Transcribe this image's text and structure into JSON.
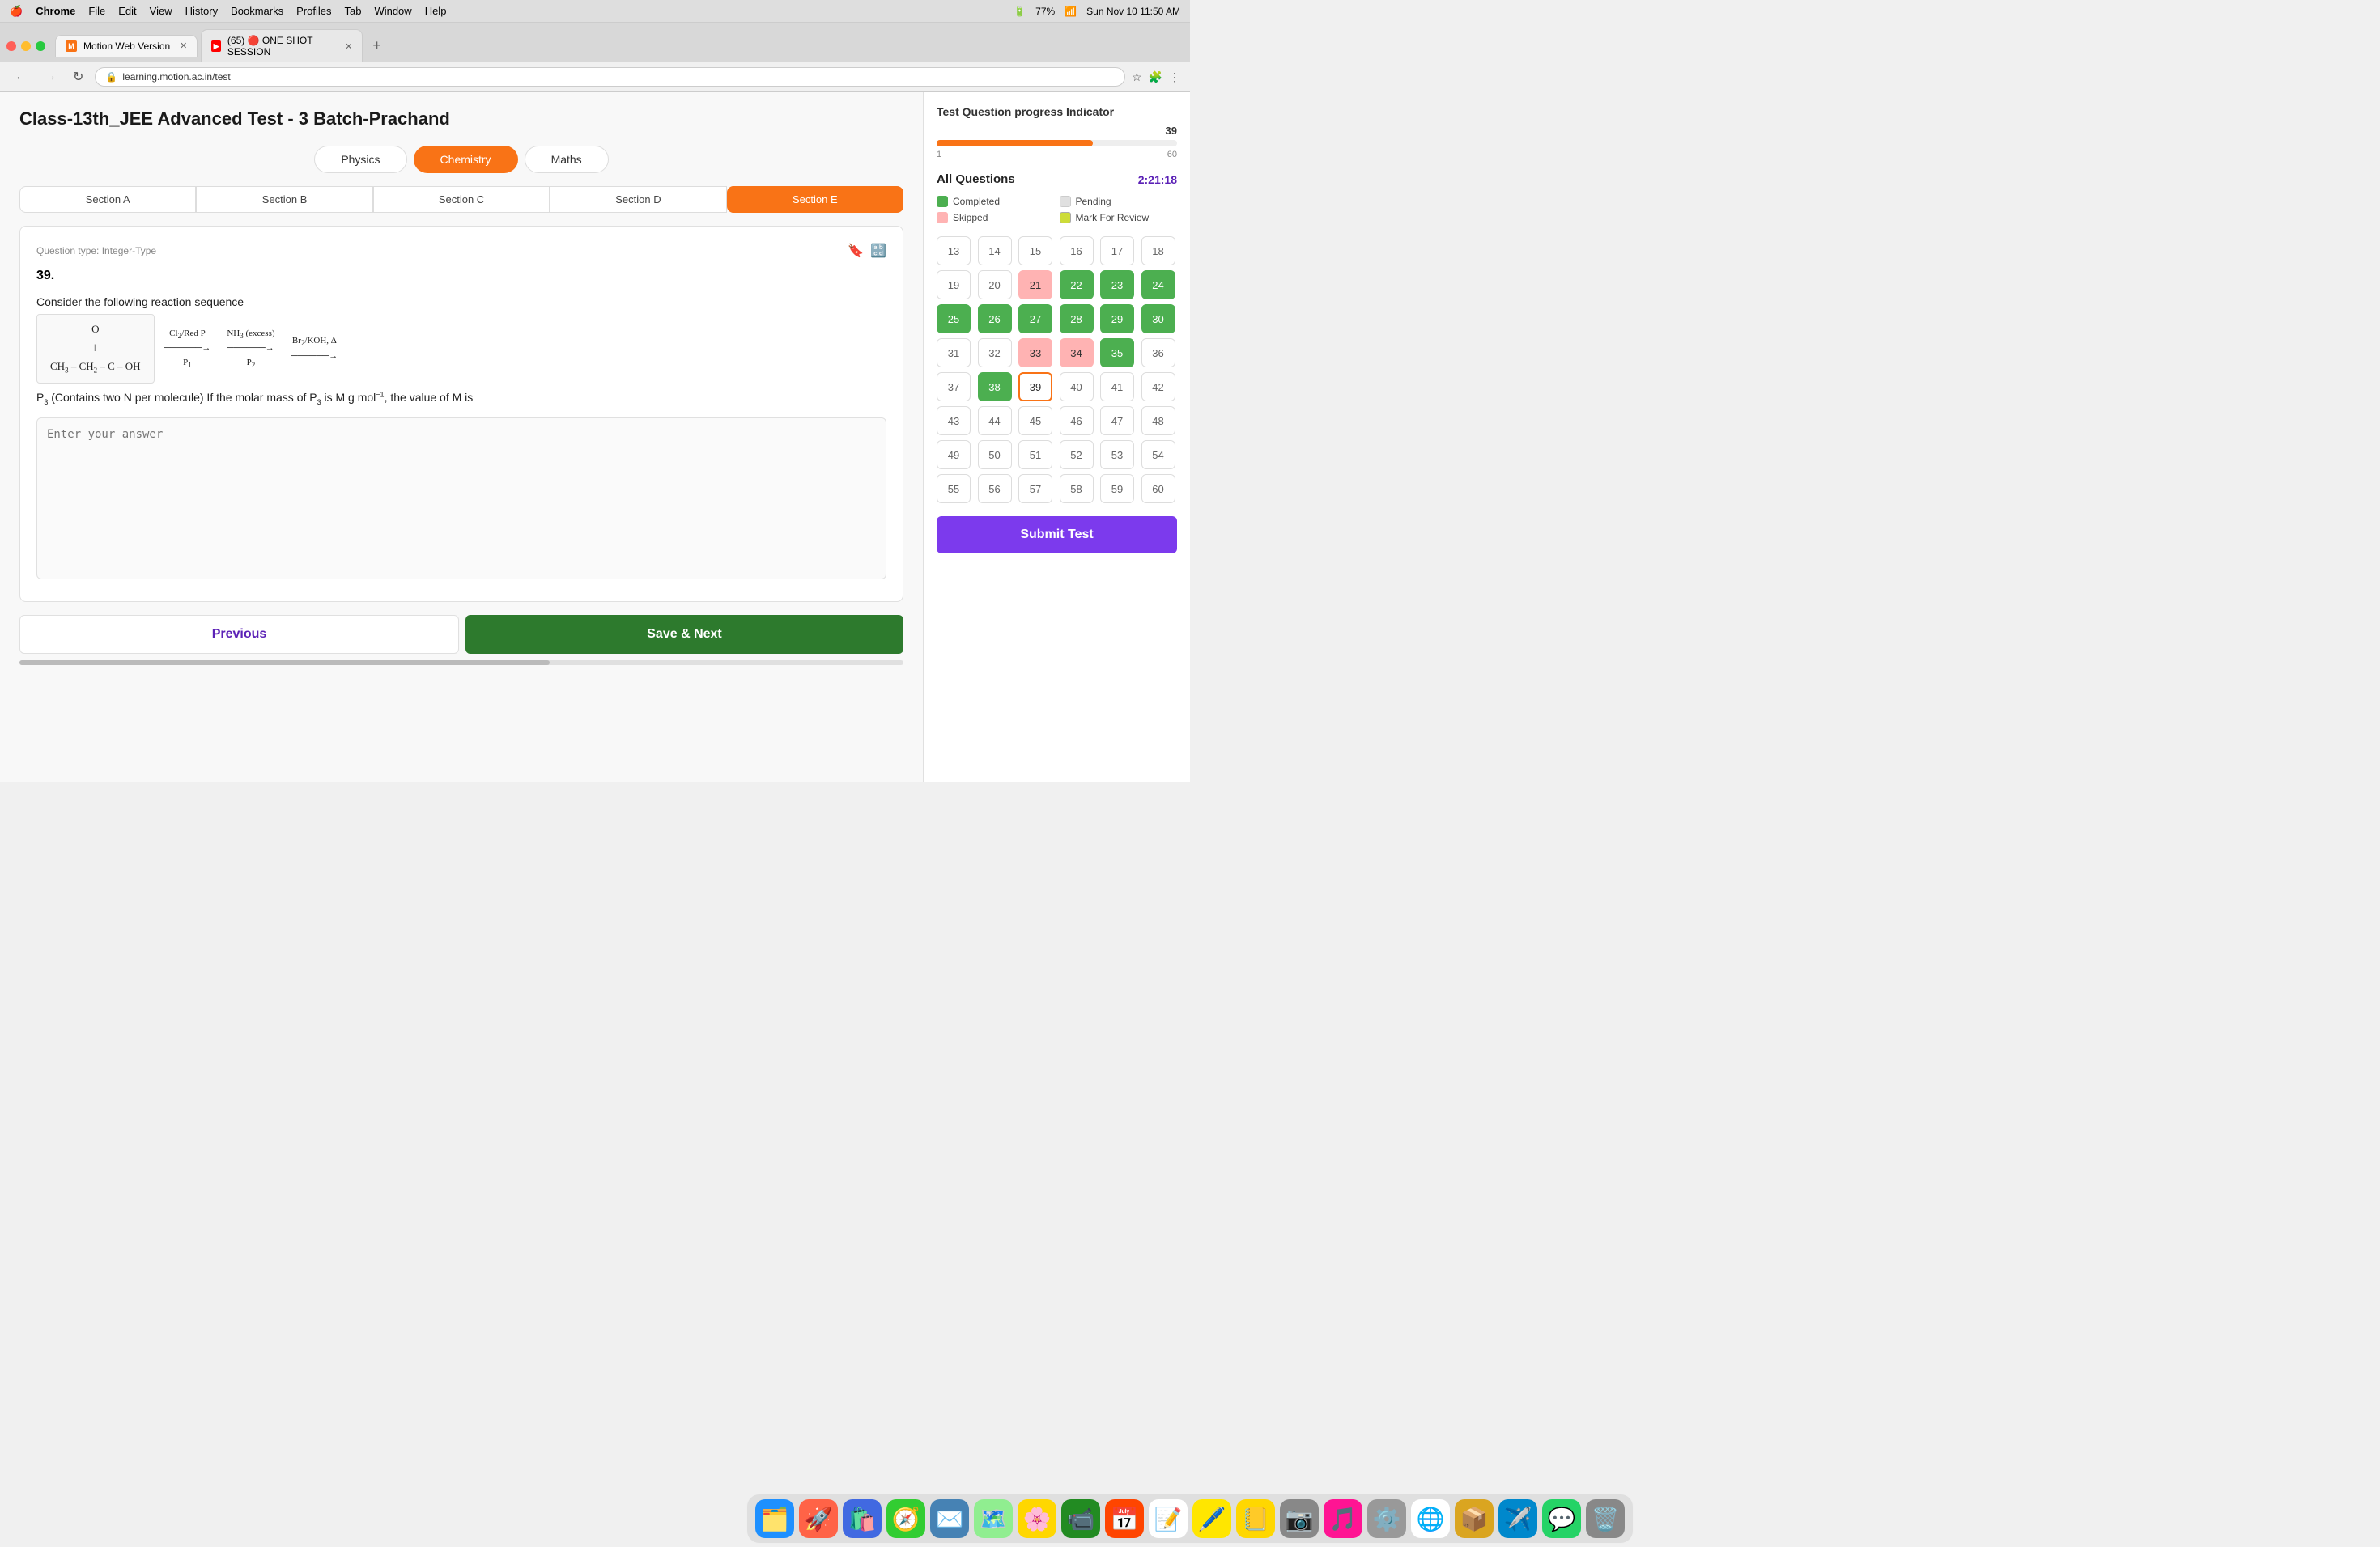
{
  "menubar": {
    "apple": "🍎",
    "app": "Chrome",
    "menus": [
      "File",
      "Edit",
      "View",
      "History",
      "Bookmarks",
      "Profiles",
      "Tab",
      "Window",
      "Help"
    ],
    "battery": "77%",
    "time": "Sun Nov 10  11:50 AM",
    "wifi": "WiFi"
  },
  "browser": {
    "tabs": [
      {
        "label": "Motion Web Version",
        "active": true,
        "favicon": "M"
      },
      {
        "label": "(65) 🔴 ONE SHOT SESSION",
        "active": false,
        "favicon": "Y"
      }
    ],
    "url": "learning.motion.ac.in/test"
  },
  "page": {
    "title": "Class-13th_JEE Advanced Test - 3 Batch-Prachand",
    "subjects": [
      "Physics",
      "Chemistry",
      "Maths"
    ],
    "active_subject": "Chemistry",
    "sections": [
      "Section A",
      "Section B",
      "Section C",
      "Section D",
      "Section E"
    ],
    "active_section": "Section E",
    "question": {
      "number": "39.",
      "type": "Question type: Integer-Type",
      "content_prefix": "Consider the following reaction sequence",
      "content_suffix": "P₃ (Contains two N per molecule) If the molar mass of P₃ is M g mol⁻¹, the value of M is",
      "answer_placeholder": "Enter your answer"
    },
    "buttons": {
      "previous": "Previous",
      "save_next": "Save & Next"
    }
  },
  "sidebar": {
    "progress": {
      "title": "Test Question progress Indicator",
      "current": "39",
      "min": "1",
      "max": "60",
      "percent": 65
    },
    "timer": "2:21:18",
    "all_questions_title": "All Questions",
    "legend": [
      {
        "label": "Completed",
        "type": "completed"
      },
      {
        "label": "Pending",
        "type": "pending"
      },
      {
        "label": "Skipped",
        "type": "skipped"
      },
      {
        "label": "Mark For Review",
        "type": "review"
      }
    ],
    "questions": [
      {
        "num": 13,
        "state": "pending"
      },
      {
        "num": 14,
        "state": "pending"
      },
      {
        "num": 15,
        "state": "pending"
      },
      {
        "num": 16,
        "state": "pending"
      },
      {
        "num": 17,
        "state": "pending"
      },
      {
        "num": 18,
        "state": "pending"
      },
      {
        "num": 19,
        "state": "pending"
      },
      {
        "num": 20,
        "state": "pending"
      },
      {
        "num": 21,
        "state": "skipped"
      },
      {
        "num": 22,
        "state": "completed"
      },
      {
        "num": 23,
        "state": "completed"
      },
      {
        "num": 24,
        "state": "completed"
      },
      {
        "num": 25,
        "state": "completed"
      },
      {
        "num": 26,
        "state": "completed"
      },
      {
        "num": 27,
        "state": "completed"
      },
      {
        "num": 28,
        "state": "completed"
      },
      {
        "num": 29,
        "state": "completed"
      },
      {
        "num": 30,
        "state": "completed"
      },
      {
        "num": 31,
        "state": "pending"
      },
      {
        "num": 32,
        "state": "pending"
      },
      {
        "num": 33,
        "state": "skipped"
      },
      {
        "num": 34,
        "state": "skipped"
      },
      {
        "num": 35,
        "state": "completed"
      },
      {
        "num": 36,
        "state": "pending"
      },
      {
        "num": 37,
        "state": "pending"
      },
      {
        "num": 38,
        "state": "completed"
      },
      {
        "num": 39,
        "state": "current"
      },
      {
        "num": 40,
        "state": "pending"
      },
      {
        "num": 41,
        "state": "pending"
      },
      {
        "num": 42,
        "state": "pending"
      },
      {
        "num": 43,
        "state": "pending"
      },
      {
        "num": 44,
        "state": "pending"
      },
      {
        "num": 45,
        "state": "pending"
      },
      {
        "num": 46,
        "state": "pending"
      },
      {
        "num": 47,
        "state": "pending"
      },
      {
        "num": 48,
        "state": "pending"
      },
      {
        "num": 49,
        "state": "pending"
      },
      {
        "num": 50,
        "state": "pending"
      },
      {
        "num": 51,
        "state": "pending"
      },
      {
        "num": 52,
        "state": "pending"
      },
      {
        "num": 53,
        "state": "pending"
      },
      {
        "num": 54,
        "state": "pending"
      },
      {
        "num": 55,
        "state": "pending"
      },
      {
        "num": 56,
        "state": "pending"
      },
      {
        "num": 57,
        "state": "pending"
      },
      {
        "num": 58,
        "state": "pending"
      },
      {
        "num": 59,
        "state": "pending"
      },
      {
        "num": 60,
        "state": "pending"
      }
    ],
    "submit_label": "Submit Test"
  },
  "dock": {
    "icons": [
      {
        "name": "finder",
        "emoji": "🗂️"
      },
      {
        "name": "launchpad",
        "emoji": "🚀"
      },
      {
        "name": "appstore",
        "emoji": "🛍️"
      },
      {
        "name": "safari",
        "emoji": "🧭"
      },
      {
        "name": "mail",
        "emoji": "✉️"
      },
      {
        "name": "maps",
        "emoji": "🗺️"
      },
      {
        "name": "photos",
        "emoji": "🌸"
      },
      {
        "name": "facetime",
        "emoji": "📹"
      },
      {
        "name": "calendar",
        "emoji": "📅"
      },
      {
        "name": "reminders",
        "emoji": "📝"
      },
      {
        "name": "miro",
        "emoji": "🖊️"
      },
      {
        "name": "notes",
        "emoji": "📒"
      },
      {
        "name": "screenshot",
        "emoji": "📷"
      },
      {
        "name": "music",
        "emoji": "🎵"
      },
      {
        "name": "preferences",
        "emoji": "⚙️"
      },
      {
        "name": "chrome",
        "emoji": "🌐"
      },
      {
        "name": "archive",
        "emoji": "📦"
      },
      {
        "name": "telegram",
        "emoji": "✈️"
      },
      {
        "name": "whatsapp",
        "emoji": "💬"
      },
      {
        "name": "trash",
        "emoji": "🗑️"
      }
    ]
  }
}
